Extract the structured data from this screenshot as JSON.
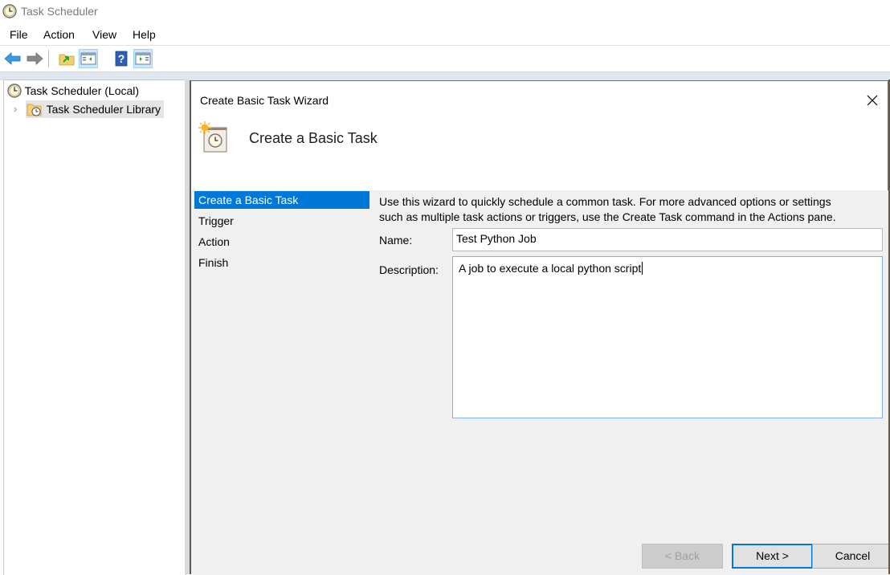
{
  "app": {
    "title": "Task Scheduler",
    "icon": "clock-icon"
  },
  "menu": [
    {
      "label": "File"
    },
    {
      "label": "Action"
    },
    {
      "label": "View"
    },
    {
      "label": "Help"
    }
  ],
  "toolbar": [
    {
      "icon": "back-arrow-icon",
      "active": false
    },
    {
      "icon": "forward-arrow-icon",
      "active": false
    },
    {
      "icon": "up-folder-icon",
      "active": false
    },
    {
      "icon": "show-hide-console-tree-icon",
      "active": true
    },
    {
      "icon": "help-icon",
      "active": false
    },
    {
      "icon": "show-hide-action-pane-icon",
      "active": true
    }
  ],
  "tree": {
    "root": {
      "label": "Task Scheduler (Local)",
      "icon": "clock-icon"
    },
    "children": [
      {
        "label": "Task Scheduler Library",
        "icon": "folder-clock-icon",
        "selected": true,
        "expander": "›"
      }
    ]
  },
  "dialog": {
    "title": "Create Basic Task Wizard",
    "close_glyph": "✕",
    "header_title": "Create a Basic Task",
    "steps": [
      {
        "label": "Create a Basic Task",
        "active": true
      },
      {
        "label": "Trigger",
        "active": false
      },
      {
        "label": "Action",
        "active": false
      },
      {
        "label": "Finish",
        "active": false
      }
    ],
    "intro_line1": "Use this wizard to quickly schedule a common task.  For more advanced options or settings",
    "intro_line2": "such as multiple task actions or triggers, use the Create Task command in the Actions pane.",
    "name_label": "Name:",
    "name_value": "Test Python Job",
    "description_label": "Description:",
    "description_value": "A job to execute a local python script",
    "buttons": {
      "back": "< Back",
      "next": "Next >",
      "cancel": "Cancel"
    },
    "colors": {
      "accent": "#0078d7",
      "body_bg": "#f0f0f0"
    }
  }
}
